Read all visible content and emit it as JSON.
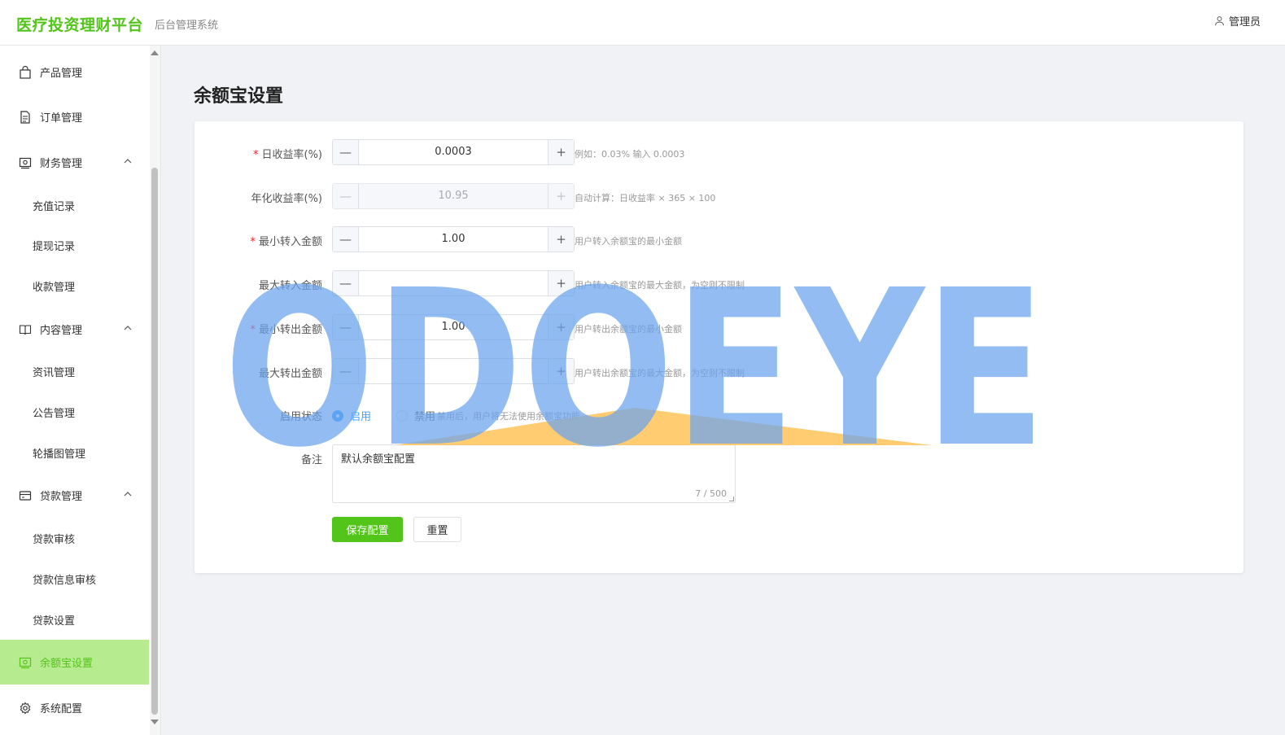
{
  "header": {
    "brand": "医疗投资理财平台",
    "subtitle": "后台管理系统",
    "user": "管理员"
  },
  "sidebar": {
    "items": [
      {
        "label": "产品管理",
        "icon": "bag-icon"
      },
      {
        "label": "订单管理",
        "icon": "document-icon"
      },
      {
        "label": "财务管理",
        "icon": "wallet-icon"
      },
      {
        "label": "充值记录"
      },
      {
        "label": "提现记录"
      },
      {
        "label": "收款管理"
      },
      {
        "label": "内容管理",
        "icon": "book-icon"
      },
      {
        "label": "资讯管理"
      },
      {
        "label": "公告管理"
      },
      {
        "label": "轮播图管理"
      },
      {
        "label": "贷款管理",
        "icon": "card-icon"
      },
      {
        "label": "贷款审核"
      },
      {
        "label": "贷款信息审核"
      },
      {
        "label": "贷款设置"
      },
      {
        "label": "余额宝设置",
        "icon": "wallet-icon",
        "active": true
      },
      {
        "label": "系统配置",
        "icon": "gear-icon"
      }
    ]
  },
  "page": {
    "title": "余额宝设置"
  },
  "form": {
    "daily_rate": {
      "label": "日收益率(%)",
      "value": "0.0003",
      "hint": "例如：0.03% 输入 0.0003"
    },
    "annual_rate": {
      "label": "年化收益率(%)",
      "value": "10.95",
      "hint": "自动计算：日收益率 × 365 × 100"
    },
    "min_in": {
      "label": "最小转入金额",
      "value": "1.00",
      "hint": "用户转入余额宝的最小金额"
    },
    "max_in": {
      "label": "最大转入金额",
      "value": "",
      "hint": "用户转入余额宝的最大金额，为空则不限制"
    },
    "min_out": {
      "label": "最小转出金额",
      "value": "1.00",
      "hint": "用户转出余额宝的最小金额"
    },
    "max_out": {
      "label": "最大转出金额",
      "value": "",
      "hint": "用户转出余额宝的最大金额，为空则不限制"
    },
    "status": {
      "label": "启用状态",
      "on": "启用",
      "off": "禁用",
      "hint": "禁用后，用户将无法使用余额宝功能"
    },
    "remark": {
      "label": "备注",
      "value": "默认余额宝配置",
      "counter": "7 / 500"
    },
    "save": "保存配置",
    "reset": "重置"
  },
  "watermark": {
    "text": "ODOEYE",
    "color": "#6aa4ee",
    "accent": "#ffbf4d"
  }
}
